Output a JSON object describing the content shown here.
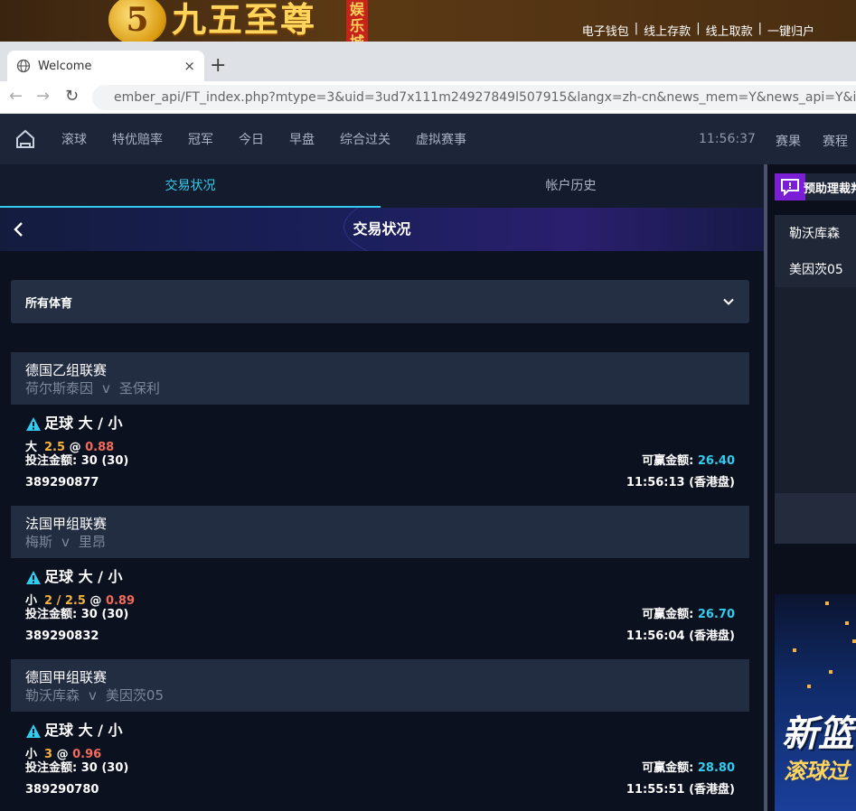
{
  "brand": {
    "logo_char": "5",
    "name": "九五至尊",
    "sub": "娱乐城"
  },
  "top_links": [
    "电子钱包",
    "线上存款",
    "线上取款",
    "一键归户"
  ],
  "top_link_sep": "|",
  "browser": {
    "tab_title": "Welcome",
    "tab_close": "×",
    "new_tab": "+",
    "url": "ember_api/FT_index.php?mtype=3&uid=3ud7x111m24927849l507915&langx=zh-cn&news_mem=Y&news_api=Y&isSSL"
  },
  "nav": {
    "items": [
      "滚球",
      "特优赔率",
      "冠军",
      "今日",
      "早盘",
      "综合过关",
      "虚拟赛事"
    ],
    "clock": "11:56:37",
    "right": [
      "赛果",
      "赛程"
    ]
  },
  "subtabs": [
    "交易状况",
    "帐户历史"
  ],
  "page_title": "交易状况",
  "filter": {
    "value": "所有体育"
  },
  "bets": [
    {
      "league": "德国乙组联赛",
      "home": "荷尔斯泰因",
      "vs": "v",
      "away": "圣保利",
      "type": "足球 大 / 小",
      "side": "大",
      "handicap": "2.5",
      "at": "@",
      "odds": "0.88",
      "stake_label": "投注金额:",
      "stake": "30 (30)",
      "win_label": "可赢金额:",
      "win": "26.40",
      "ticket": "389290877",
      "time": "11:56:13 (香港盘)"
    },
    {
      "league": "法国甲组联赛",
      "home": "梅斯",
      "vs": "v",
      "away": "里昂",
      "type": "足球 大 / 小",
      "side": "小",
      "handicap": "2 / 2.5",
      "at": "@",
      "odds": "0.89",
      "stake_label": "投注金额:",
      "stake": "30 (30)",
      "win_label": "可赢金额:",
      "win": "26.70",
      "ticket": "389290832",
      "time": "11:56:04 (香港盘)"
    },
    {
      "league": "德国甲组联赛",
      "home": "勒沃库森",
      "vs": "v",
      "away": "美因茨05",
      "type": "足球 大 / 小",
      "side": "小",
      "handicap": "3",
      "at": "@",
      "odds": "0.96",
      "stake_label": "投注金额:",
      "stake": "30 (30)",
      "win_label": "可赢金额:",
      "win": "28.80",
      "ticket": "389290780",
      "time": "11:55:51 (香港盘)"
    }
  ],
  "right_panel": {
    "header": "预助理裁判",
    "items": [
      "勒沃库森",
      "美因茨05"
    ],
    "promo_big": "新篮",
    "promo_small": "滚球过"
  },
  "colors": {
    "accent": "#33ccee",
    "handicap": "#f3b33d",
    "odds": "#f26b5b"
  }
}
